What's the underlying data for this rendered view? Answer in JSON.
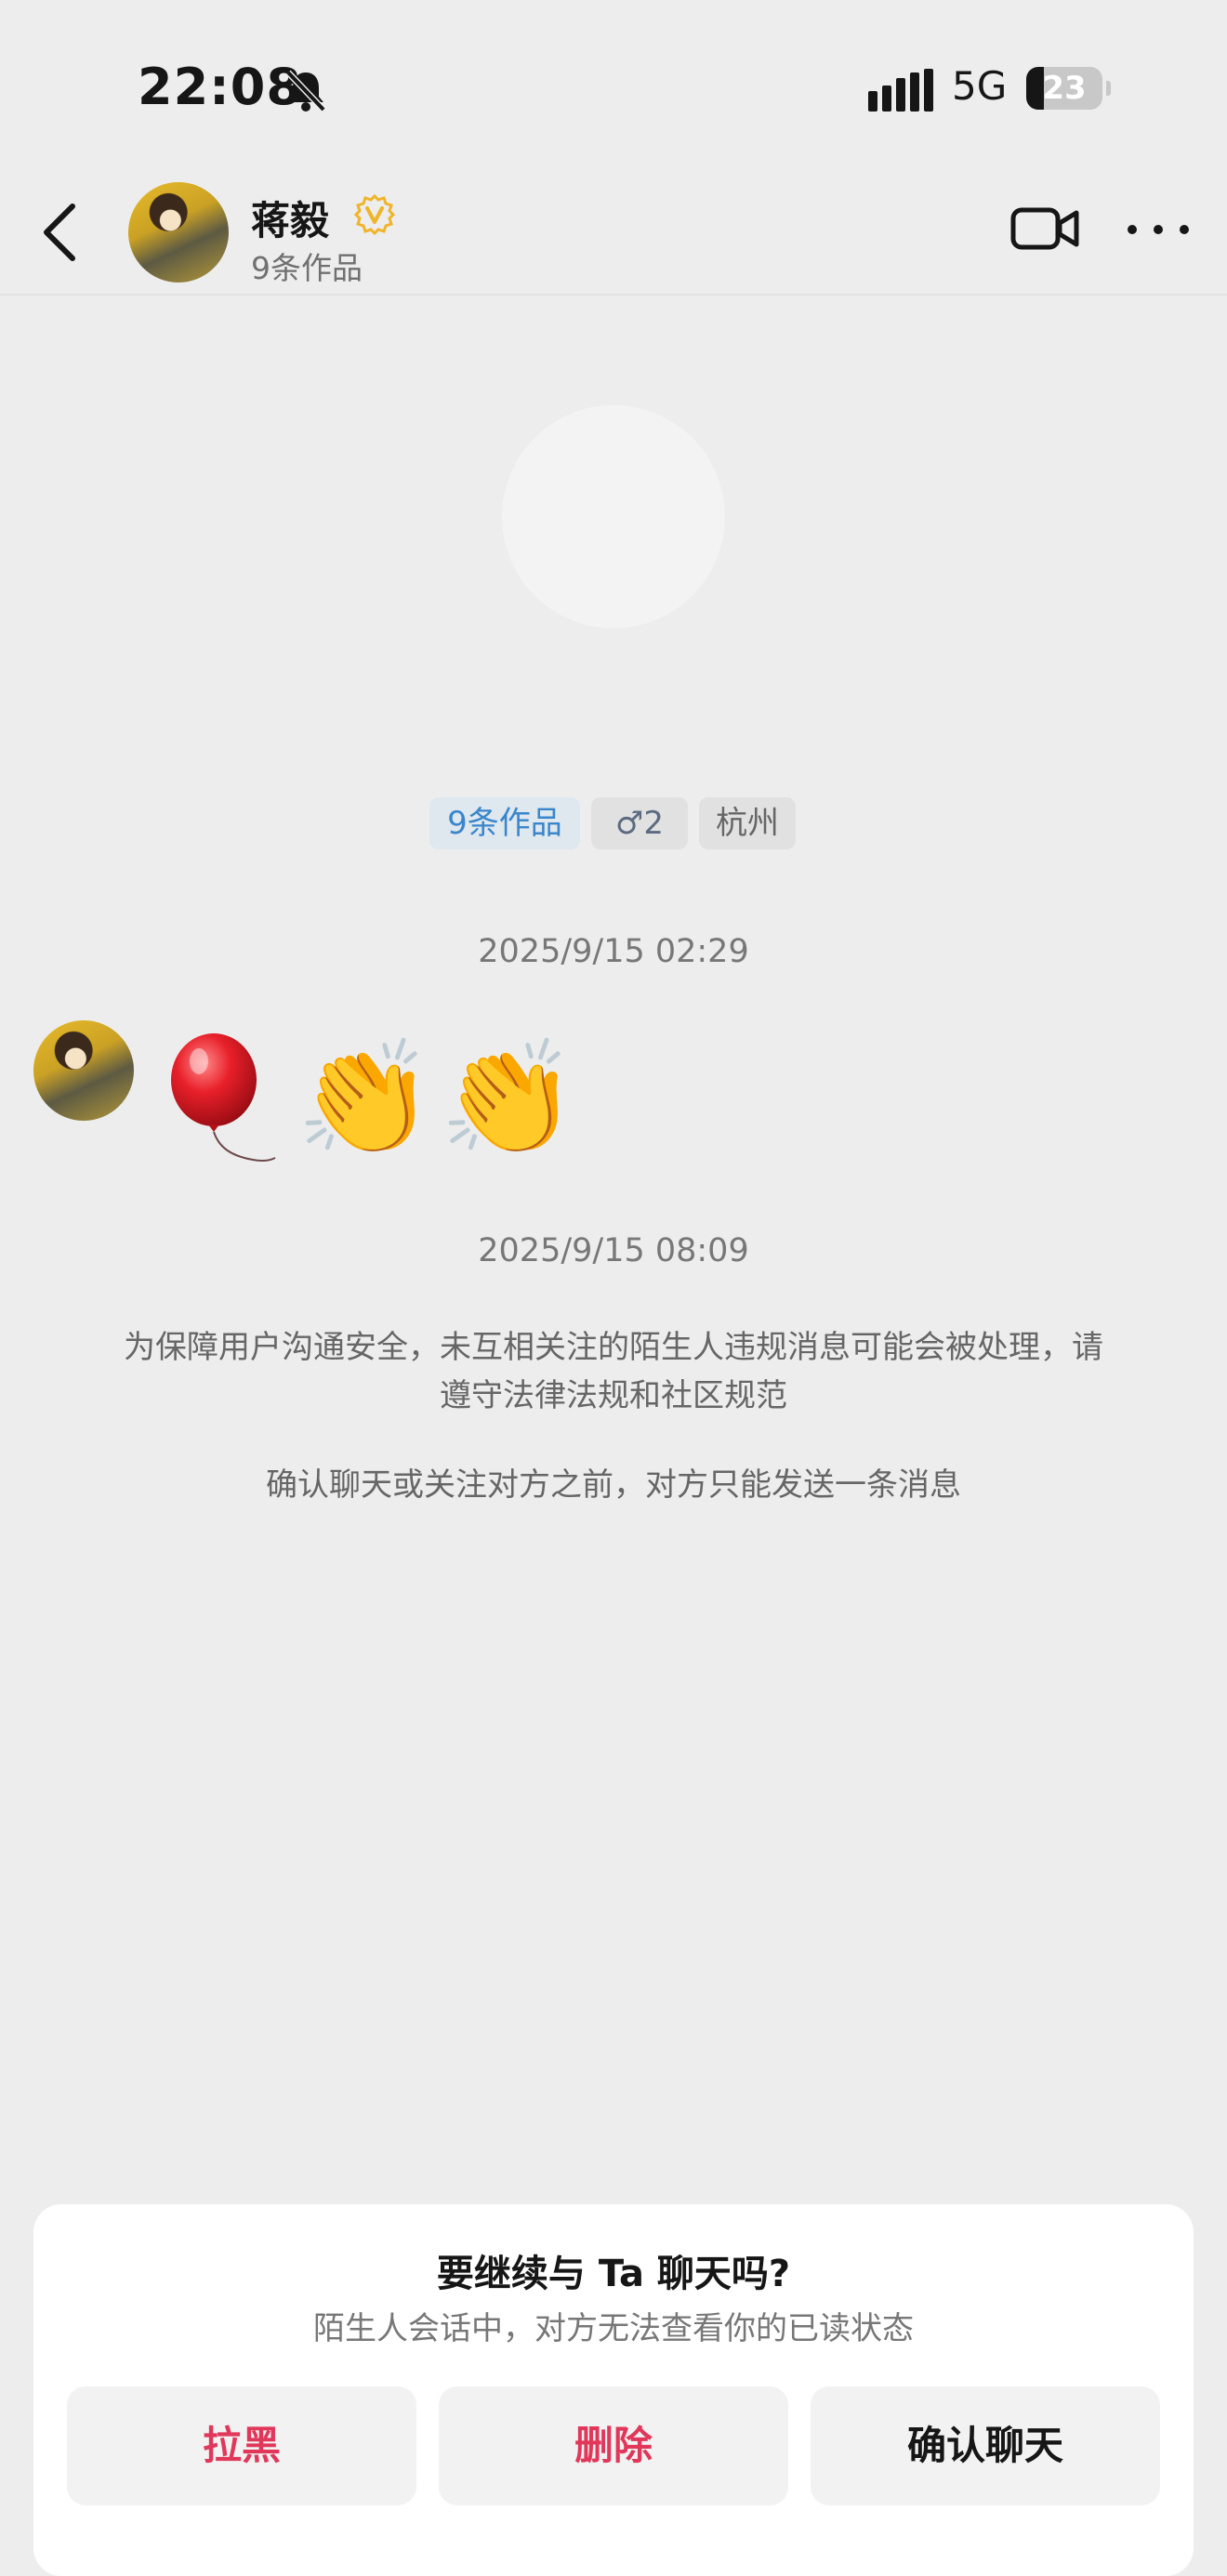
{
  "status_bar": {
    "time": "22:08",
    "network": "5G",
    "battery": "23",
    "battery_level_percent": 23,
    "icons": [
      "bell-muted-icon",
      "signal-icon",
      "battery-icon"
    ]
  },
  "header": {
    "name": "蒋毅",
    "subtitle": "9条作品",
    "icons": [
      "back-icon",
      "verified-icon",
      "video-call-icon",
      "more-icon"
    ]
  },
  "profile_tags": {
    "works": "9条作品",
    "gender": "♂2",
    "city": "杭州"
  },
  "timestamps": [
    "2025/9/15 02:29",
    "2025/9/15 08:09"
  ],
  "message": {
    "content": [
      "🎈",
      "👏",
      "👏"
    ]
  },
  "notices": [
    "为保障用户沟通安全，未互相关注的陌生人违规消息可能会被处理，请遵守法律法规和社区规范",
    "确认聊天或关注对方之前，对方只能发送一条消息"
  ],
  "dialog": {
    "title": "要继续与 Ta 聊天吗?",
    "subtitle": "陌生人会话中，对方无法查看你的已读状态",
    "buttons": {
      "block": "拉黑",
      "delete": "删除",
      "confirm": "确认聊天"
    }
  },
  "colors": {
    "background": "#ededed",
    "danger": "#e0375a",
    "link_blue": "#3a86cc",
    "verified_gold": "#f0b428"
  }
}
